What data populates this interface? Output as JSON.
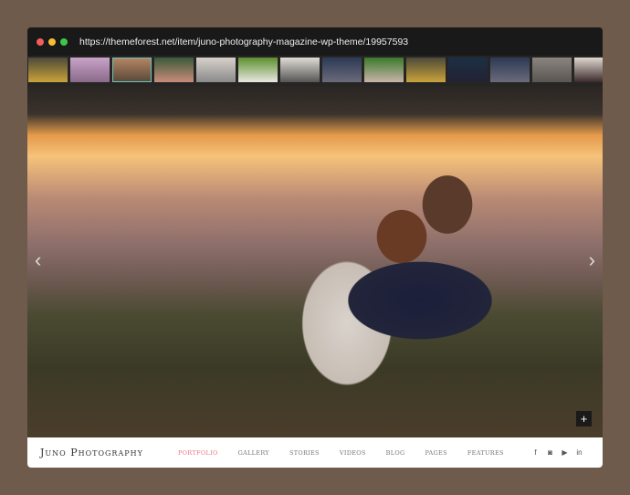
{
  "browser": {
    "url": "https://themeforest.net/item/juno-photography-magazine-wp-theme/19957593",
    "dots": [
      "#f25f58",
      "#f6be30",
      "#3ec746"
    ]
  },
  "thumbnails": [
    {
      "colors": [
        "#4b4a3a",
        "#caa33b"
      ]
    },
    {
      "colors": [
        "#c8a3c9",
        "#8a6a8a"
      ]
    },
    {
      "colors": [
        "#b38462",
        "#5a4a3a"
      ],
      "selected": true
    },
    {
      "colors": [
        "#3a5a3a",
        "#c88c7a"
      ]
    },
    {
      "colors": [
        "#d7d1cb",
        "#8a8a8a"
      ]
    },
    {
      "colors": [
        "#5c8f2e",
        "#e8e8e0"
      ]
    },
    {
      "colors": [
        "#e0ddd5",
        "#555"
      ]
    },
    {
      "colors": [
        "#2c3a55",
        "#6b6a7a"
      ]
    },
    {
      "colors": [
        "#3a7a2a",
        "#c8b4a8"
      ]
    },
    {
      "colors": [
        "#4b4a3a",
        "#caa33b"
      ]
    },
    {
      "colors": [
        "#1c2f45",
        "#223"
      ]
    },
    {
      "colors": [
        "#2c3a55",
        "#6b6a7a"
      ]
    },
    {
      "colors": [
        "#8a8580",
        "#5a5550"
      ]
    },
    {
      "colors": [
        "#e0d8d0",
        "#3a2a2a"
      ]
    }
  ],
  "slider": {
    "prev_icon": "chevron-left-icon",
    "next_icon": "chevron-right-icon",
    "expand_icon": "+"
  },
  "site": {
    "logo": "Juno Photography",
    "menu": [
      "PORTFOLIO",
      "GALLERY",
      "STORIES",
      "VIDEOS",
      "BLOG",
      "PAGES",
      "FEATURES"
    ],
    "active": "PORTFOLIO",
    "accent": "#e8798a",
    "social": [
      {
        "name": "facebook",
        "glyph": "f"
      },
      {
        "name": "instagram",
        "glyph": "◙"
      },
      {
        "name": "youtube",
        "glyph": "▶"
      },
      {
        "name": "linkedin",
        "glyph": "in"
      }
    ]
  }
}
